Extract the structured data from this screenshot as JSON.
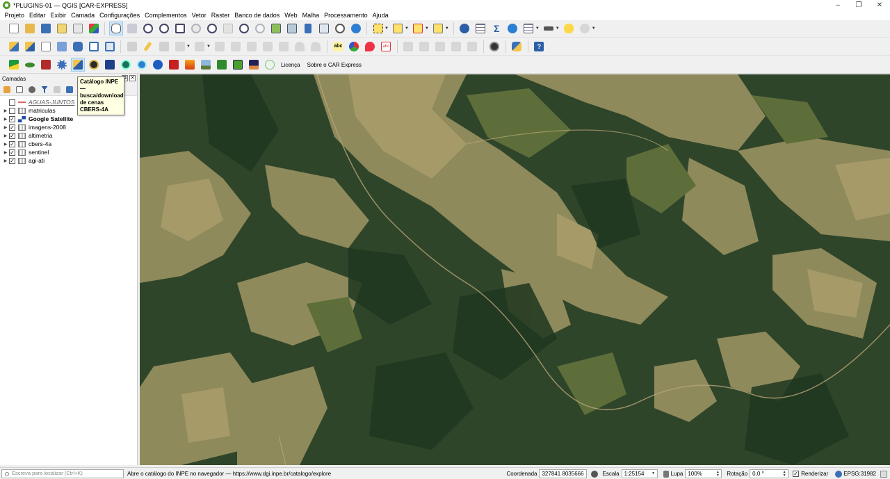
{
  "window": {
    "title": "*PLUGINS-01 — QGIS [CAR-EXPRESS]",
    "controls": {
      "minimize": "–",
      "maximize": "❐",
      "close": "✕"
    }
  },
  "menu": [
    "Projeto",
    "Editar",
    "Exibir",
    "Camada",
    "Configurações",
    "Complementos",
    "Vetor",
    "Raster",
    "Banco de dados",
    "Web",
    "Malha",
    "Processamento",
    "Ajuda"
  ],
  "plugin_toolbar": {
    "license_label": "Licença",
    "about_label": "Sobre o CAR Express"
  },
  "tooltip": {
    "lines": [
      "Catálogo INPE —",
      "busca/download",
      "de cenas",
      "CBERS-4A"
    ]
  },
  "layers_panel": {
    "title": "Camadas",
    "float_btn": "⧉",
    "close_btn": "✕",
    "layers": [
      {
        "name": "AGUAS-JUNTOS",
        "checked": false,
        "expandable": false,
        "style": "italic",
        "symbol": "line"
      },
      {
        "name": "matriculas",
        "checked": false,
        "expandable": true,
        "style": "normal",
        "symbol": "raster"
      },
      {
        "name": "Google Satellite",
        "checked": true,
        "expandable": true,
        "style": "bold",
        "symbol": "google"
      },
      {
        "name": "imagens-2008",
        "checked": true,
        "expandable": true,
        "style": "normal",
        "symbol": "raster"
      },
      {
        "name": "altimetria",
        "checked": true,
        "expandable": true,
        "style": "normal",
        "symbol": "raster"
      },
      {
        "name": "cbers-4a",
        "checked": true,
        "expandable": true,
        "style": "normal",
        "symbol": "raster"
      },
      {
        "name": "sentinel",
        "checked": true,
        "expandable": true,
        "style": "normal",
        "symbol": "raster"
      },
      {
        "name": "agi-ati",
        "checked": true,
        "expandable": true,
        "style": "normal",
        "symbol": "raster"
      }
    ]
  },
  "statusbar": {
    "locator_placeholder": "Escreva para localizar (Ctrl+K)",
    "message": "Abre o catálogo do INPE no navegador — https://www.dgi.inpe.br/catalogo/explore",
    "coordinate_label": "Coordenada",
    "coordinate_value": "327841  8035666",
    "scale_label": "Escala",
    "scale_value": "1:25154",
    "magnifier_label": "Lupa",
    "magnifier_value": "100%",
    "rotation_label": "Rotação",
    "rotation_value": "0,0 °",
    "render_label": "Renderizar",
    "render_checked": true,
    "crs_label": "EPSG:31982"
  },
  "colors": {
    "accent": "#cce4f7",
    "tooltip_bg": "#ffffe1",
    "qgis_green": "#5a9c2d"
  }
}
